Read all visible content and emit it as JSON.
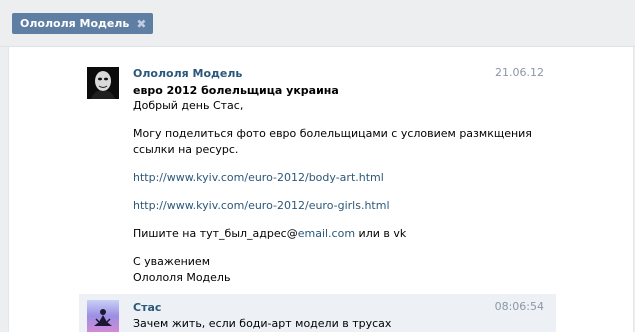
{
  "header": {
    "chip_label": "Олололя Модель",
    "chip_close_glyph": "✖"
  },
  "messages": [
    {
      "author": "Олололя Модель",
      "date": "21.06.12",
      "subject": "евро 2012 болельщица украина",
      "greeting": "Добрый день Стас,",
      "body_line1": "Могу поделиться фото евро болельщицами с условием размкщения",
      "body_line2": "ссылки на ресурс.",
      "link1": "http://www.kyiv.com/euro-2012/body-art.html",
      "link2": "http://www.kyiv.com/euro-2012/euro-girls.html",
      "contact_prefix": "Пишите на тут_был_адрес@",
      "contact_link": "email.com",
      "contact_suffix": " или в vk",
      "closing": "С уважением",
      "signature": "Олололя Модель",
      "avatar_icon": "dark-masked-face-avatar"
    },
    {
      "author": "Стас",
      "time": "08:06:54",
      "text": "Зачем жить, если боди-арт модели в трусах",
      "avatar_icon": "meditation-silhouette-avatar"
    }
  ],
  "colors": {
    "chip_bg": "#5f7ea3",
    "link": "#2b587a",
    "date": "#8c97a6",
    "highlight_bg": "#edf1f5"
  }
}
